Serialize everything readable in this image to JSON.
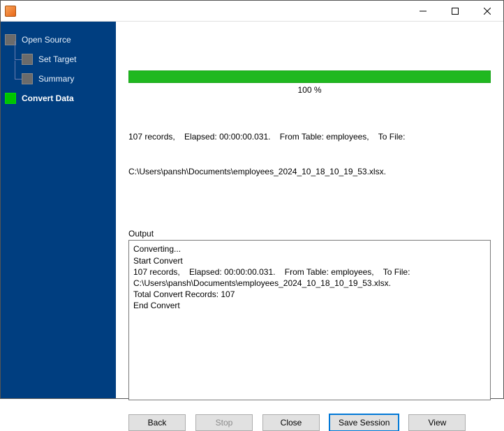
{
  "sidebar": {
    "items": [
      {
        "label": "Open Source"
      },
      {
        "label": "Set Target"
      },
      {
        "label": "Summary"
      },
      {
        "label": "Convert Data"
      }
    ]
  },
  "progress": {
    "percent_label": "100 %"
  },
  "status": {
    "line1": "107 records,    Elapsed: 00:00:00.031.    From Table: employees,    To File:",
    "line2": "C:\\Users\\pansh\\Documents\\employees_2024_10_18_10_19_53.xlsx."
  },
  "output": {
    "label": "Output",
    "text": "Converting...\nStart Convert\n107 records,    Elapsed: 00:00:00.031.    From Table: employees,    To File: C:\\Users\\pansh\\Documents\\employees_2024_10_18_10_19_53.xlsx.\nTotal Convert Records: 107\nEnd Convert"
  },
  "buttons": {
    "back": "Back",
    "stop": "Stop",
    "close": "Close",
    "save_session": "Save Session",
    "view": "View"
  }
}
